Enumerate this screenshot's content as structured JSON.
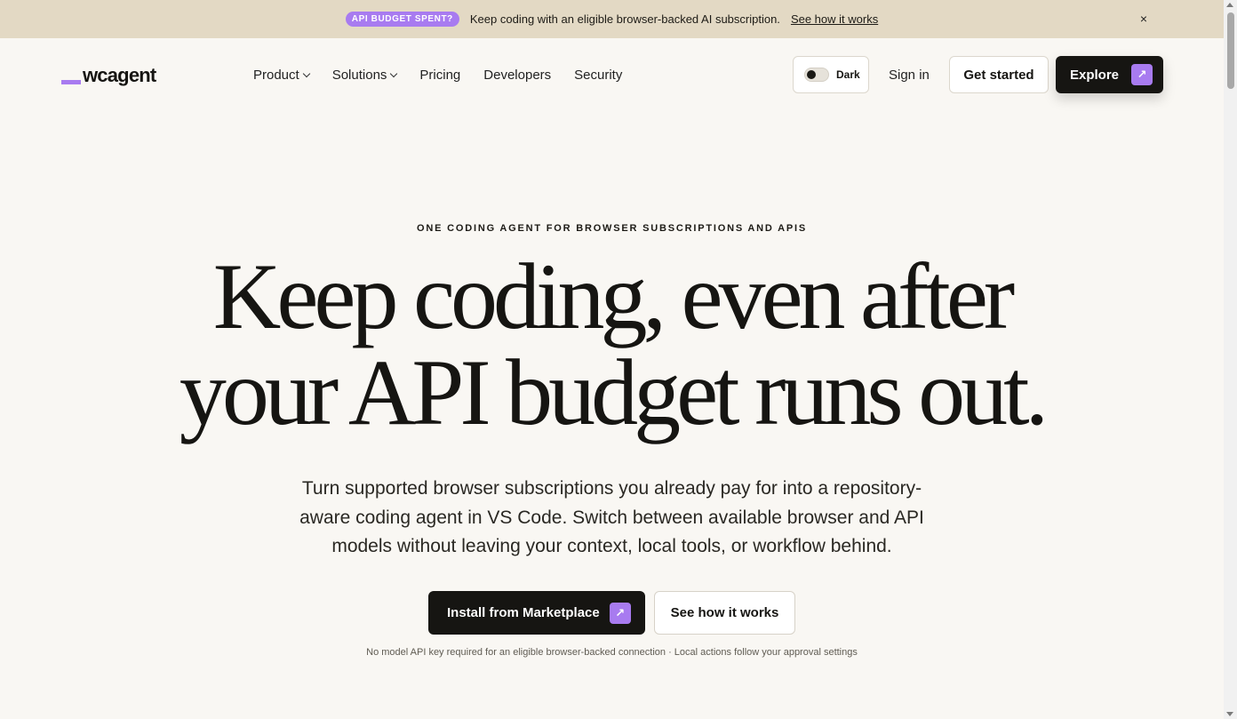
{
  "banner": {
    "badge": "API BUDGET SPENT?",
    "message": "Keep coding with an eligible browser-backed AI subscription.",
    "link": "See how it works",
    "close": "×"
  },
  "nav": {
    "logo": "wcagent",
    "items": [
      {
        "label": "Product",
        "dropdown": true
      },
      {
        "label": "Solutions",
        "dropdown": true
      },
      {
        "label": "Pricing"
      },
      {
        "label": "Developers"
      },
      {
        "label": "Security"
      }
    ],
    "theme_toggle_label": "Dark",
    "sign_in": "Sign in",
    "get_started": "Get started",
    "explore": "Explore"
  },
  "hero": {
    "eyebrow": "ONE CODING AGENT FOR BROWSER SUBSCRIPTIONS AND APIS",
    "headline_line1": "Keep coding, even after",
    "headline_line2": "your API budget runs out.",
    "subtext": "Turn supported browser subscriptions you already pay for into a repository-aware coding agent in VS Code. Switch between available browser and API models without leaving your context, local tools, or workflow behind.",
    "primary_cta": "Install from Marketplace",
    "secondary_cta": "See how it works",
    "footnote": "No model API key required for an eligible browser-backed connection · Local actions follow your approval settings"
  },
  "icons": {
    "arrow": "↗",
    "chevron": "chevron-down-icon"
  },
  "colors": {
    "accent": "#a87bf0",
    "banner_bg": "#e3d9c4",
    "page_bg": "#f9f7f3",
    "dark": "#161512"
  }
}
